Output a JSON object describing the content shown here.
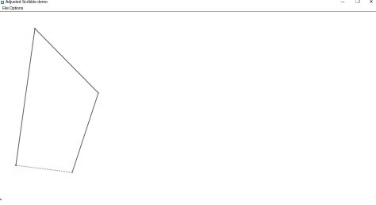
{
  "window": {
    "title": "Adjusted Scribble demo",
    "icon": "app-icon",
    "controls": [
      "─",
      "❐",
      "✕"
    ]
  },
  "menu": {
    "items": [
      "File",
      "Options"
    ]
  },
  "drawing": {
    "stroke_color": "#606060",
    "vertex_color": "#cc3333",
    "dash_color": "#b0b0b0"
  }
}
